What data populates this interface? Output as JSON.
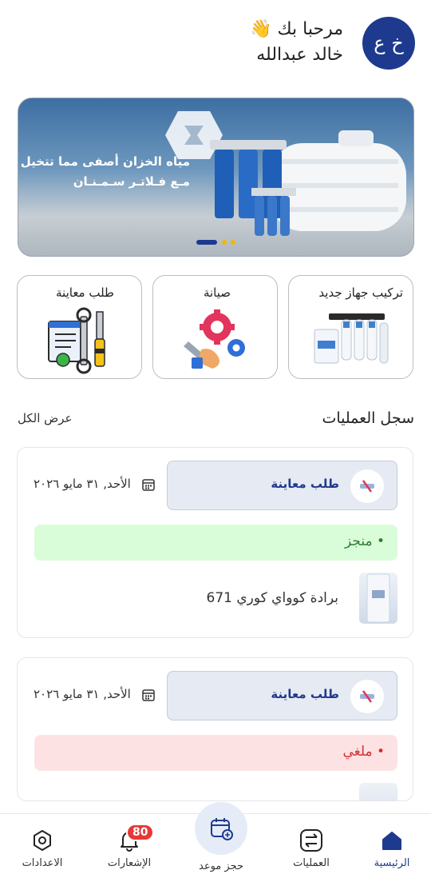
{
  "header": {
    "avatar_initials": "خ ع",
    "greeting": "مرحبا بك 👋",
    "user_name": "خالد عبدالله"
  },
  "banner": {
    "line1": "مياه الخزان أصفى مما تتخيل",
    "line2": "مـع فـلاتـر سـمـنـان",
    "active_slide_index": 0,
    "slide_count": 3
  },
  "services": [
    {
      "label": "تركيب جهاز جديد",
      "icon": "water-filter-icon"
    },
    {
      "label": "صيانة",
      "icon": "wrench-gear-icon"
    },
    {
      "label": "طلب معاينة",
      "icon": "inspection-tools-icon"
    }
  ],
  "operations": {
    "title": "سجل العمليات",
    "view_all": "عرض الكل",
    "records": [
      {
        "type": "طلب معاينة",
        "date": "الأحد, ٣١ مايو ٢٠٢٦",
        "status": "• منجز",
        "status_color": "#2e7d32",
        "status_bg": "#d9fcd9",
        "product": "برادة كوواي كوري 671"
      },
      {
        "type": "طلب معاينة",
        "date": "الأحد, ٣١ مايو ٢٠٢٦",
        "status": "• ملغي",
        "status_color": "#d32f2f",
        "status_bg": "#fde2e4",
        "product": ""
      }
    ]
  },
  "bottom_nav": {
    "items": [
      {
        "label": "الرئيسية",
        "icon": "home-icon",
        "active": true
      },
      {
        "label": "العمليات",
        "icon": "transfer-icon",
        "active": false
      },
      {
        "label": "حجز موعد",
        "icon": "calendar-add-icon",
        "active": false
      },
      {
        "label": "الإشعارات",
        "icon": "bell-icon",
        "active": false,
        "badge": "80"
      },
      {
        "label": "الاعدادات",
        "icon": "settings-icon",
        "active": false
      }
    ]
  },
  "colors": {
    "primary": "#1e3a8f",
    "active_nav": "#1e3a8f"
  }
}
